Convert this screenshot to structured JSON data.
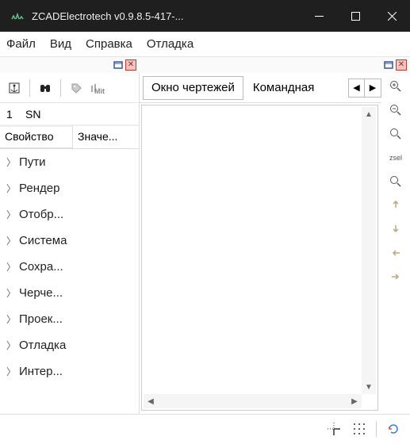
{
  "window": {
    "title": "ZCADElectrotech v0.9.8.5-417-..."
  },
  "menu": {
    "file": "Файл",
    "view": "Вид",
    "help": "Справка",
    "debug": "Отладка"
  },
  "tabs": {
    "drawings": "Окно чертежей",
    "command": "Командная"
  },
  "side": {
    "row1_num": "1",
    "row1_sn": "SN",
    "prop": "Свойство",
    "val": "Значе...",
    "items": {
      "paths": "Пути",
      "render": "Рендер",
      "display": "Отобр...",
      "system": "Система",
      "save": "Сохра...",
      "draw": "Черче...",
      "proj": "Проек...",
      "dbg": "Отладка",
      "intf": "Интер..."
    }
  },
  "right": {
    "zsel": "zsel"
  }
}
